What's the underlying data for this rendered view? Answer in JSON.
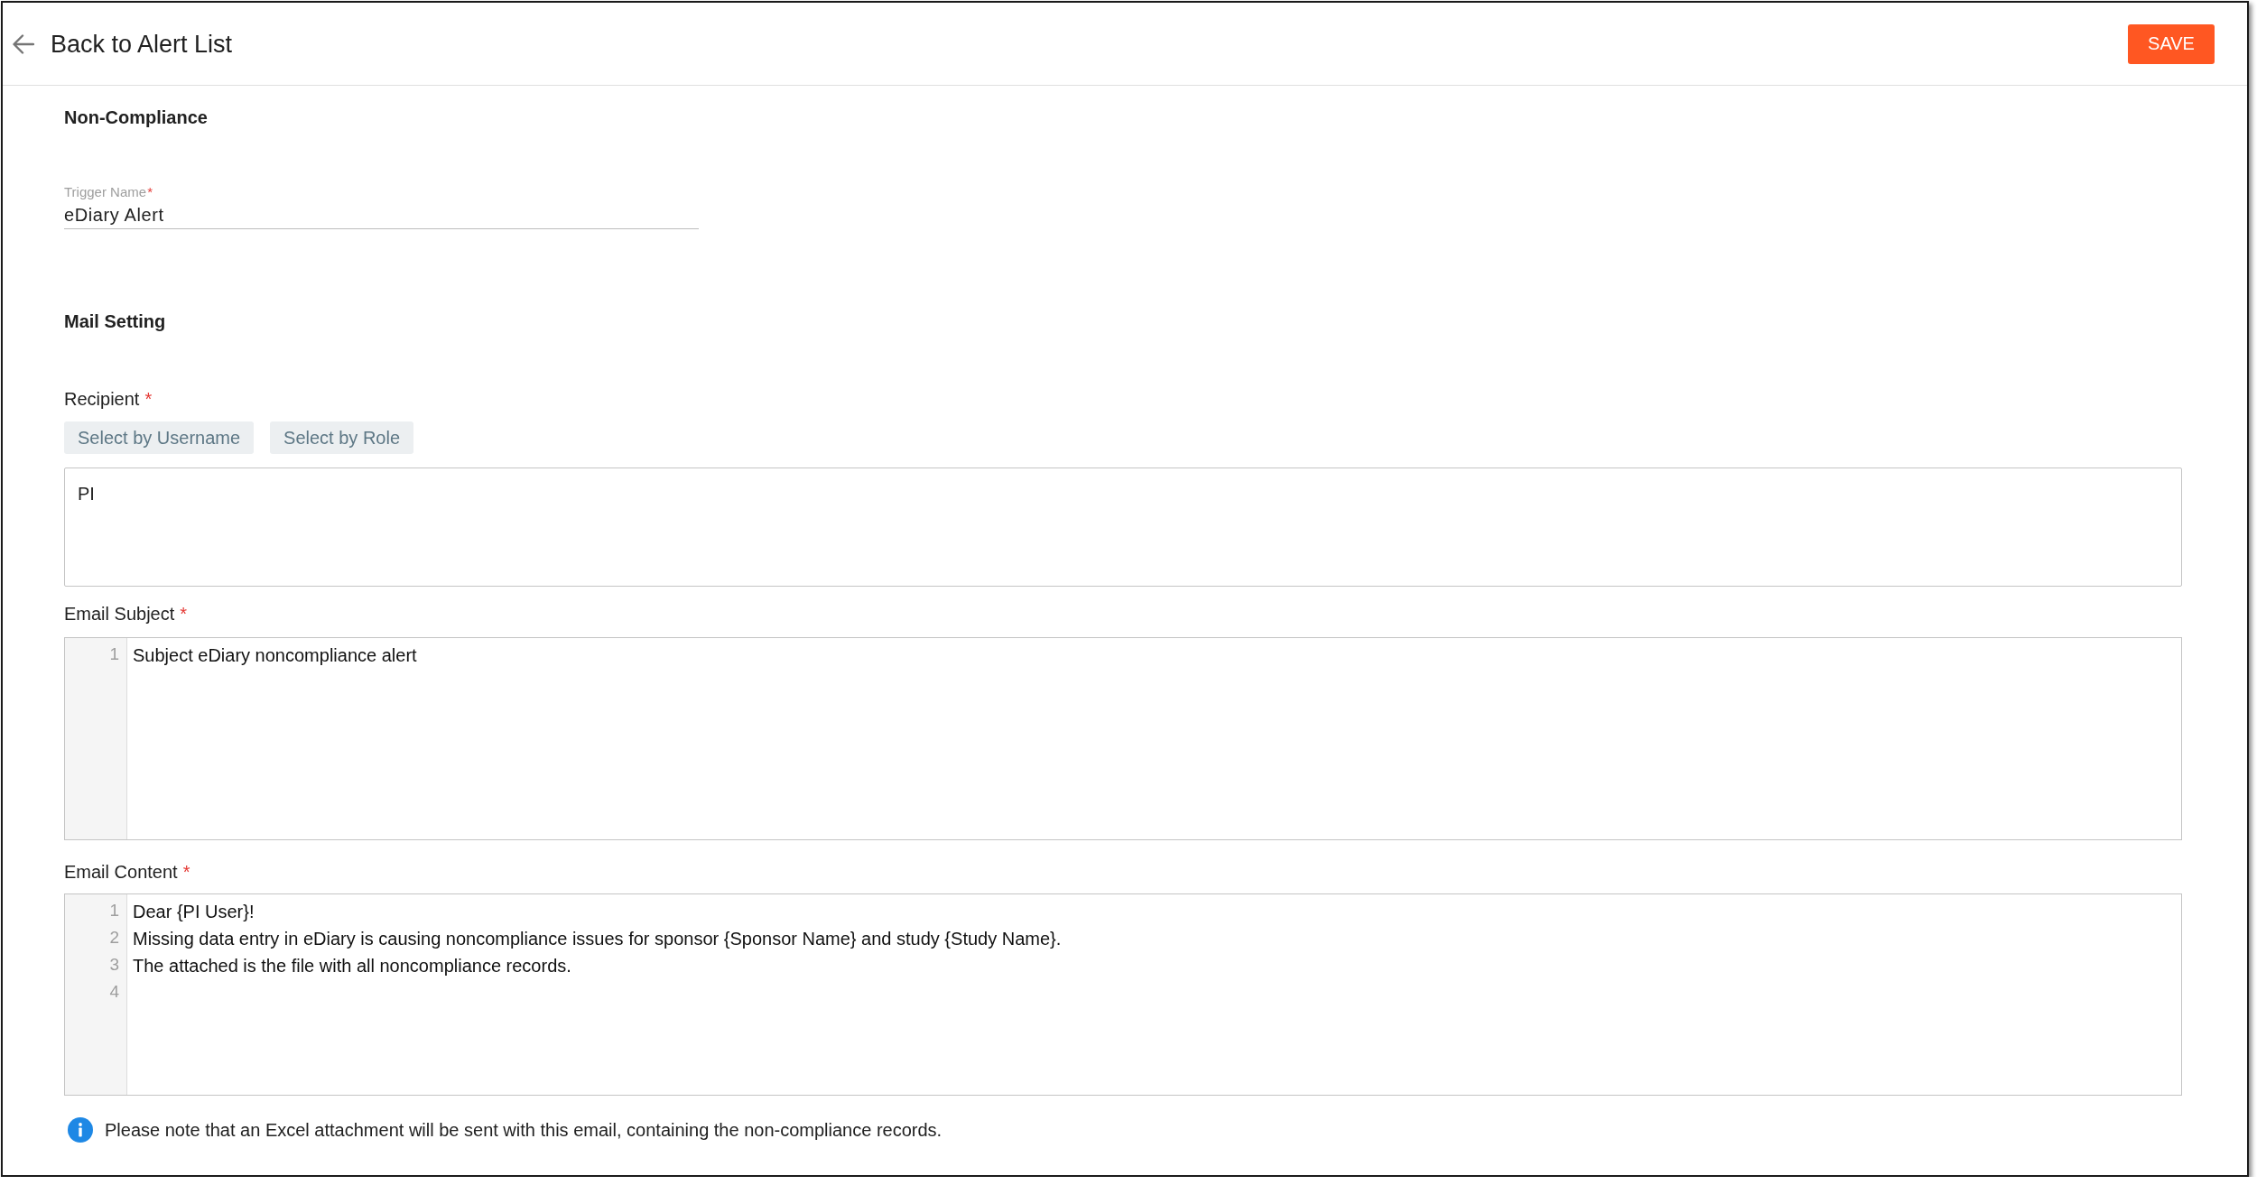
{
  "header": {
    "back_label": "Back to Alert List",
    "save_label": "SAVE"
  },
  "non_compliance": {
    "title": "Non-Compliance",
    "trigger_name": {
      "label": "Trigger Name",
      "required_mark": "*",
      "value": "eDiary Alert"
    }
  },
  "mail_setting": {
    "title": "Mail Setting",
    "recipient": {
      "label": "Recipient",
      "required_mark": "*",
      "buttons": [
        "Select by Username",
        "Select by Role"
      ],
      "value": "PI"
    },
    "email_subject": {
      "label": "Email Subject",
      "required_mark": "*",
      "lines": [
        {
          "number": "1",
          "text": "Subject eDiary noncompliance alert"
        }
      ]
    },
    "email_content": {
      "label": "Email Content",
      "required_mark": "*",
      "lines": [
        {
          "number": "1",
          "text": "Dear {PI User}!"
        },
        {
          "number": "2",
          "text": "Missing data entry in eDiary is causing noncompliance issues for sponsor {Sponsor Name} and study {Study Name}."
        },
        {
          "number": "3",
          "text": "The attached is the file with all noncompliance records."
        },
        {
          "number": "4"
        }
      ]
    },
    "note": "Please note that an Excel attachment will be sent with this email, containing the non-compliance records."
  }
}
